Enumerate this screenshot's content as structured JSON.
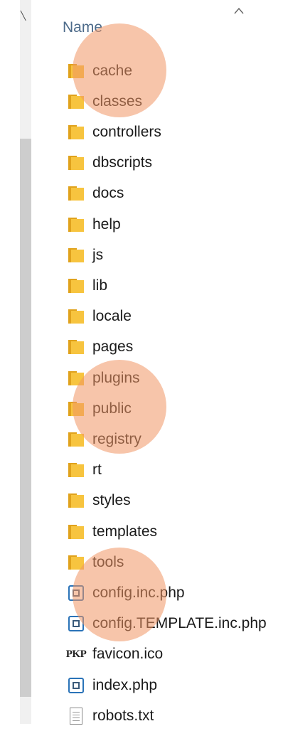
{
  "header": {
    "name_column": "Name"
  },
  "files": [
    {
      "name": "cache",
      "icon": "folder-icon"
    },
    {
      "name": "classes",
      "icon": "folder-icon"
    },
    {
      "name": "controllers",
      "icon": "folder-icon"
    },
    {
      "name": "dbscripts",
      "icon": "folder-icon"
    },
    {
      "name": "docs",
      "icon": "folder-icon"
    },
    {
      "name": "help",
      "icon": "folder-icon"
    },
    {
      "name": "js",
      "icon": "folder-icon"
    },
    {
      "name": "lib",
      "icon": "folder-icon"
    },
    {
      "name": "locale",
      "icon": "folder-icon"
    },
    {
      "name": "pages",
      "icon": "folder-icon"
    },
    {
      "name": "plugins",
      "icon": "folder-icon"
    },
    {
      "name": "public",
      "icon": "folder-icon"
    },
    {
      "name": "registry",
      "icon": "folder-icon"
    },
    {
      "name": "rt",
      "icon": "folder-icon"
    },
    {
      "name": "styles",
      "icon": "folder-icon"
    },
    {
      "name": "templates",
      "icon": "folder-icon"
    },
    {
      "name": "tools",
      "icon": "folder-icon"
    },
    {
      "name": "config.inc.php",
      "icon": "php-file-icon"
    },
    {
      "name": "config.TEMPLATE.inc.php",
      "icon": "php-file-icon"
    },
    {
      "name": "favicon.ico",
      "icon": "pkp-icon",
      "icon_text": "PKP"
    },
    {
      "name": "index.php",
      "icon": "php-file-icon"
    },
    {
      "name": "robots.txt",
      "icon": "text-file-icon"
    }
  ],
  "colors": {
    "folder": "#f7c43f",
    "folder_dark": "#e0a21c",
    "highlight": "#f0a078",
    "header_text": "#4d6b8a",
    "php_icon_border": "#2a73b8"
  }
}
